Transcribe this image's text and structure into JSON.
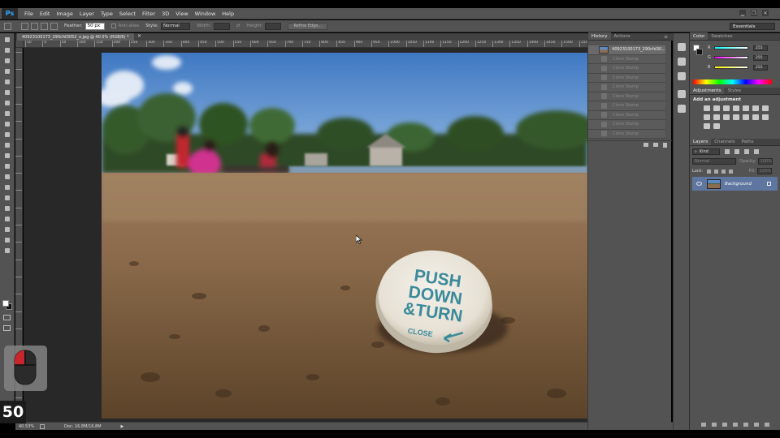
{
  "app": {
    "logo": "Ps",
    "menu": [
      "File",
      "Edit",
      "Image",
      "Layer",
      "Type",
      "Select",
      "Filter",
      "3D",
      "View",
      "Window",
      "Help"
    ],
    "window_controls": [
      "minimize",
      "restore",
      "close"
    ]
  },
  "options_bar": {
    "feather_label": "Feather:",
    "feather_value": "50 px",
    "anti_alias_label": "Anti-alias",
    "style_label": "Style:",
    "style_value": "Normal",
    "width_label": "Width:",
    "height_label": "Height:",
    "refine_edge_label": "Refine Edge...",
    "workspace": "Essentials"
  },
  "document": {
    "tab_title": "40923100173_290cfd3052_o.jpg @ 40.5% (RGB/8) *",
    "ruler_labels": [
      "50",
      "0",
      "50",
      "100",
      "150",
      "200",
      "250",
      "300",
      "350",
      "400",
      "450",
      "500",
      "550",
      "600",
      "650",
      "700",
      "750",
      "800",
      "850",
      "900",
      "950",
      "1000",
      "1050",
      "1100",
      "1150",
      "1200",
      "1250",
      "1300",
      "1350",
      "1400",
      "1450",
      "1500",
      "1550"
    ],
    "photo_text": {
      "line1": "PUSH",
      "line2": "DOWN",
      "line3": "&TURN",
      "line4": "CLOSE"
    }
  },
  "status_bar": {
    "zoom": "40.53%",
    "doc_size": "Doc: 16.8M/16.8M"
  },
  "history_panel": {
    "tabs": [
      "History",
      "Actions"
    ],
    "snapshot_name": "40923100173_290cfd30...",
    "steps": [
      "Clone Stamp",
      "Clone Stamp",
      "Clone Stamp",
      "Clone Stamp",
      "Clone Stamp",
      "Clone Stamp",
      "Clone Stamp",
      "Clone Stamp",
      "Clone Stamp"
    ]
  },
  "color_panel": {
    "tabs": [
      "Color",
      "Swatches"
    ],
    "channels": [
      {
        "label": "R",
        "value": "255"
      },
      {
        "label": "G",
        "value": "255"
      },
      {
        "label": "B",
        "value": "255"
      }
    ]
  },
  "adjustments_panel": {
    "tabs": [
      "Adjustments",
      "Styles"
    ],
    "heading": "Add an adjustment"
  },
  "layers_panel": {
    "tabs": [
      "Layers",
      "Channels",
      "Paths"
    ],
    "kind_label": "Kind",
    "blend_mode": "Normal",
    "opacity_label": "Opacity:",
    "opacity_value": "100%",
    "lock_label": "Lock:",
    "fill_label": "Fill:",
    "fill_value": "100%",
    "layer_name": "Background"
  },
  "overlay": {
    "counter": "50"
  }
}
